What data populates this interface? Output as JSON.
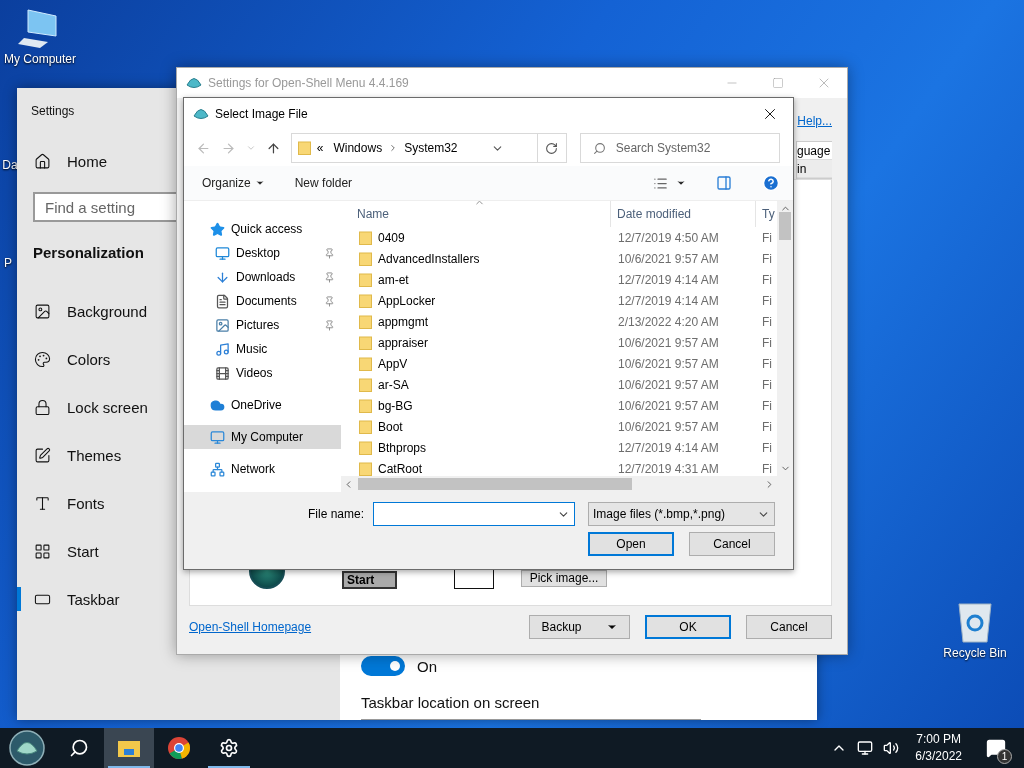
{
  "desktop": {
    "icons": [
      {
        "label": "My Computer",
        "kind": "computer"
      },
      {
        "label": "Da",
        "kind": "partial"
      },
      {
        "label": "P",
        "kind": "partial"
      },
      {
        "label": "Recycle Bin",
        "kind": "recycle-bin"
      }
    ]
  },
  "settings_window": {
    "title": "Settings",
    "home": "Home",
    "search": {
      "placeholder": "Find a setting"
    },
    "section": "Personalization",
    "nav": [
      {
        "label": "Background",
        "kind": "background",
        "selected": false
      },
      {
        "label": "Colors",
        "kind": "colors",
        "selected": false
      },
      {
        "label": "Lock screen",
        "kind": "lock-screen",
        "selected": false
      },
      {
        "label": "Themes",
        "kind": "themes",
        "selected": false
      },
      {
        "label": "Fonts",
        "kind": "fonts",
        "selected": false
      },
      {
        "label": "Start",
        "kind": "start",
        "selected": false
      },
      {
        "label": "Taskbar",
        "kind": "taskbar",
        "selected": true
      }
    ],
    "toggle": {
      "on": true,
      "label": "On"
    },
    "location_label": "Taskbar location on screen"
  },
  "openshell_window": {
    "title": "Settings for Open-Shell Menu 4.4.169",
    "help_link": "Help...",
    "column_fragment": {
      "header": "guage",
      "cell": "in"
    },
    "images": {
      "start_button_text": "Start",
      "pick_button": "Pick image..."
    },
    "homepage_link": "Open-Shell Homepage",
    "buttons": [
      {
        "label": "Backup",
        "kind": "split"
      },
      {
        "label": "OK",
        "kind": "default"
      },
      {
        "label": "Cancel",
        "kind": "plain"
      }
    ]
  },
  "dialog": {
    "title": "Select Image File",
    "address": {
      "prefix": "«",
      "parts": [
        "Windows",
        "System32"
      ]
    },
    "search": {
      "placeholder": "Search System32"
    },
    "toolbar": {
      "organize": "Organize",
      "new_folder": "New folder"
    },
    "nav_pane": [
      {
        "label": "Quick access",
        "kind": "quick-access",
        "selected": false,
        "children": [
          {
            "label": "Desktop",
            "kind": "desktop",
            "pinned": true,
            "selected": false
          },
          {
            "label": "Downloads",
            "kind": "downloads",
            "pinned": true,
            "selected": false
          },
          {
            "label": "Documents",
            "kind": "documents",
            "pinned": true,
            "selected": false
          },
          {
            "label": "Pictures",
            "kind": "pictures",
            "pinned": true,
            "selected": false
          },
          {
            "label": "Music",
            "kind": "music",
            "pinned": false,
            "selected": false
          },
          {
            "label": "Videos",
            "kind": "videos",
            "pinned": false,
            "selected": false
          }
        ]
      },
      {
        "label": "OneDrive",
        "kind": "onedrive",
        "selected": false
      },
      {
        "label": "My Computer",
        "kind": "computer",
        "selected": true
      },
      {
        "label": "Network",
        "kind": "network",
        "selected": false
      }
    ],
    "columns": [
      "Name",
      "Date modified",
      "Ty"
    ],
    "rows": [
      {
        "name": "0409",
        "date": "12/7/2019 4:50 AM",
        "type": "Fi"
      },
      {
        "name": "AdvancedInstallers",
        "date": "10/6/2021 9:57 AM",
        "type": "Fi"
      },
      {
        "name": "am-et",
        "date": "12/7/2019 4:14 AM",
        "type": "Fi"
      },
      {
        "name": "AppLocker",
        "date": "12/7/2019 4:14 AM",
        "type": "Fi"
      },
      {
        "name": "appmgmt",
        "date": "2/13/2022 4:20 AM",
        "type": "Fi"
      },
      {
        "name": "appraiser",
        "date": "10/6/2021 9:57 AM",
        "type": "Fi"
      },
      {
        "name": "AppV",
        "date": "10/6/2021 9:57 AM",
        "type": "Fi"
      },
      {
        "name": "ar-SA",
        "date": "10/6/2021 9:57 AM",
        "type": "Fi"
      },
      {
        "name": "bg-BG",
        "date": "10/6/2021 9:57 AM",
        "type": "Fi"
      },
      {
        "name": "Boot",
        "date": "10/6/2021 9:57 AM",
        "type": "Fi"
      },
      {
        "name": "Bthprops",
        "date": "12/7/2019 4:14 AM",
        "type": "Fi"
      },
      {
        "name": "CatRoot",
        "date": "12/7/2019 4:31 AM",
        "type": "Fi"
      }
    ],
    "file_name_label": "File name:",
    "filter": "Image files (*.bmp,*.png)",
    "buttons": [
      {
        "label": "Open",
        "kind": "default"
      },
      {
        "label": "Cancel",
        "kind": "plain"
      }
    ]
  },
  "taskbar": {
    "apps": [
      {
        "kind": "start"
      },
      {
        "kind": "search"
      },
      {
        "kind": "explorer",
        "active": true,
        "running": true
      },
      {
        "kind": "chrome",
        "active": false,
        "running": false
      },
      {
        "kind": "settings",
        "active": false,
        "running": true
      }
    ],
    "clock": {
      "time": "7:00 PM",
      "date": "6/3/2022"
    },
    "notifications": {
      "count": "1"
    }
  }
}
